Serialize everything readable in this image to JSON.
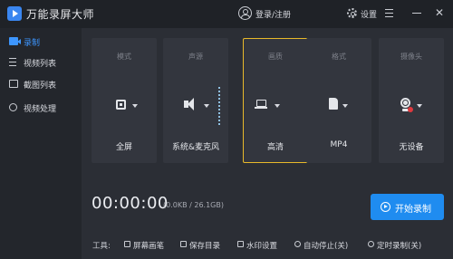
{
  "app": {
    "title": "万能录屏大师"
  },
  "header": {
    "login_label": "登录/注册",
    "settings_label": "设置"
  },
  "sidebar": {
    "items": [
      {
        "label": "录制",
        "icon": "video-camera-icon",
        "active": true
      },
      {
        "label": "视频列表",
        "icon": "video-list-icon"
      },
      {
        "label": "截图列表",
        "icon": "screenshot-list-icon"
      },
      {
        "label": "视频处理",
        "icon": "video-process-icon"
      }
    ]
  },
  "cards": [
    {
      "title": "模式",
      "value": "全屏",
      "icon": "fullscreen-icon"
    },
    {
      "title": "声源",
      "value": "系统&麦克风",
      "icon": "speaker-icon"
    },
    {
      "title": "画质",
      "value": "高清",
      "icon": "monitor-icon",
      "selected": true
    },
    {
      "title": "格式",
      "value": "MP4",
      "icon": "file-icon"
    },
    {
      "title": "摄像头",
      "value": "无设备",
      "icon": "webcam-icon"
    }
  ],
  "recording": {
    "timer": "00:00:00",
    "size": "(0.0KB / 26.1GB)",
    "start_label": "开始录制"
  },
  "tools": {
    "label": "工具:",
    "items": [
      {
        "label": "屏幕画笔",
        "icon": "pen-icon"
      },
      {
        "label": "保存目录",
        "icon": "folder-icon"
      },
      {
        "label": "水印设置",
        "icon": "watermark-icon"
      },
      {
        "label": "自动停止(关)",
        "icon": "clock-icon"
      },
      {
        "label": "定时录制(关)",
        "icon": "timer-icon"
      }
    ]
  },
  "colors": {
    "accent": "#1f8cf0",
    "selected_border": "#e8b92a"
  }
}
